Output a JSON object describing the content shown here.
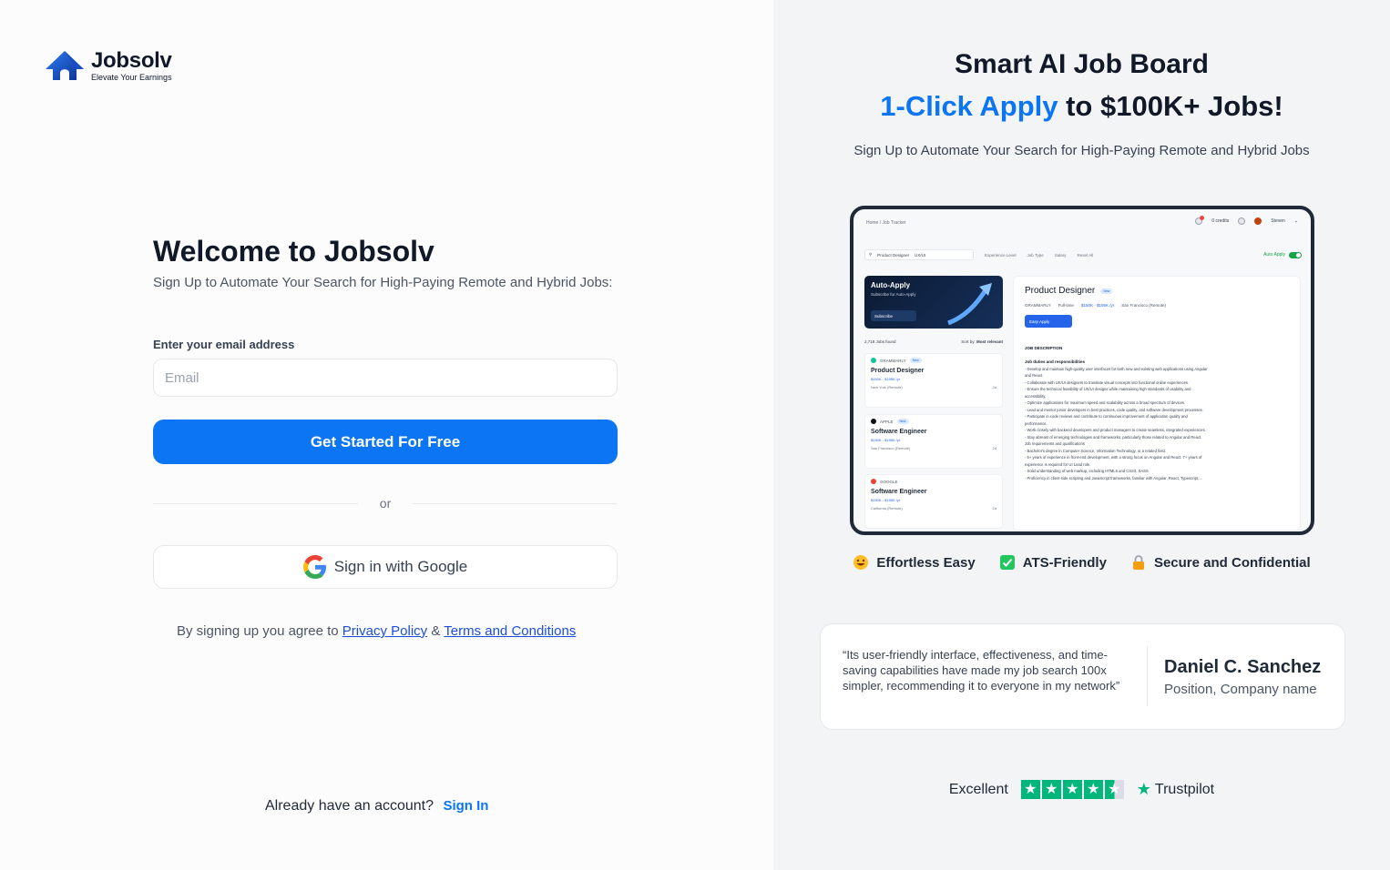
{
  "brand": {
    "name": "Jobsolv",
    "tagline": "Elevate Your Earnings"
  },
  "signup": {
    "title": "Welcome to Jobsolv",
    "subtitle": "Sign Up to Automate Your Search for High-Paying Remote and Hybrid Jobs:",
    "email_label": "Enter your email address",
    "email_placeholder": "Email",
    "email_value": "",
    "cta_label": "Get Started For Free",
    "or_label": "or",
    "google_label": "Sign in with Google",
    "agree_prefix": "By signing up you agree to",
    "privacy_label": "Privacy Policy",
    "amp": "&",
    "terms_label": "Terms and Conditions",
    "already_label": "Already have an account?",
    "signin_label": "Sign In"
  },
  "hero": {
    "title": "Smart AI Job Board",
    "title2_highlight": "1-Click Apply",
    "title2_rest": " to $100K+ Jobs!",
    "subtitle": "Sign Up to Automate Your Search for High-Paying Remote and Hybrid Jobs"
  },
  "preview": {
    "breadcrumb": "Home / Job Tracker",
    "credits": "0 credits",
    "user": "Steven",
    "search_chip1": "Product Designer",
    "search_chip2": "UX/UI",
    "filters": [
      "Experience Level",
      "Job Type",
      "Salary",
      "Reset All"
    ],
    "auto_apply_label": "Auto Apply",
    "promo_title": "Auto-Apply",
    "promo_sub": "Subscribe for Auto-Apply",
    "promo_btn": "Subscribe",
    "jobs_found": "2,718 Jobs found",
    "sort_label": "Sort by:",
    "sort_value": "Most relevant",
    "new_badge": "New",
    "jobs": [
      {
        "company": "GRAMMARLY",
        "title": "Product Designer",
        "salary": "$150K - $195K /yr",
        "location": "New York (Remote)",
        "age": "2d",
        "logo_color": "#15c39a"
      },
      {
        "company": "APPLE",
        "title": "Software Engineer",
        "salary": "$150K - $195K /yr",
        "location": "San Francisco (Remote)",
        "age": "2d",
        "logo_color": "#111111"
      },
      {
        "company": "GOOGLE",
        "title": "Software Engineer",
        "salary": "$150K - $195K /yr",
        "location": "California (Remote)",
        "age": "2d",
        "logo_color": "#ea4335"
      }
    ],
    "detail": {
      "title": "Product Designer",
      "company": "GRAMMARLY",
      "job_type": "Full-time",
      "salary": "$150K - $195K /yr",
      "location": "San Francisco (Remote)",
      "apply_label": "Easy Apply",
      "section": "JOB DESCRIPTION",
      "duties_title": "Job duties and responsibilities",
      "lines": [
        "- Develop and maintain high-quality user interfaces for both new and existing web applications using Angular",
        "and React.",
        "- Collaborate with UX/UI designers to translate visual concepts into functional online experiences.",
        "- Ensure the technical feasibility of UX/UI designs while maintaining high standards of usability and",
        "accessibility.",
        "- Optimize applications for maximum speed and scalability across a broad spectrum of devices.",
        "- Lead and mentor junior developers in best practices, code quality, and software development processes.",
        "- Participate in code reviews and contribute to continuous improvement of application quality and",
        "performance.",
        "- Work closely with backend developers and product managers to create seamless, integrated experiences.",
        "- Stay abreast of emerging technologies and frameworks, particularly those related to Angular and React.",
        "Job requirements and qualifications",
        "- Bachelor's degree in Computer Science, Information Technology, or a related field.",
        "- 5+ years of experience in front-end development, with a strong focus on Angular and React. 7+ years of",
        "experience is required for UI Lead role.",
        "- Solid understanding of web markup, including HTML5 and CSS3, SASS.",
        "- Proficiency in client-side scripting and JavaScript frameworks, familiar with Angular, React, Typescript,..."
      ]
    }
  },
  "features": [
    {
      "icon": "grin-face-icon",
      "glyph": "😄",
      "label": "Effortless Easy"
    },
    {
      "icon": "checkmark-box-icon",
      "glyph": "✓",
      "label": "ATS-Friendly"
    },
    {
      "icon": "lock-icon",
      "glyph": "🔒",
      "label": "Secure and Confidential"
    }
  ],
  "testimonial": {
    "quote": "“Its user-friendly interface, effectiveness, and time-saving capabilities have made my job search 100x simpler, recommending it to everyone in my network”",
    "name": "Daniel C. Sanchez",
    "position": "Position, Company name"
  },
  "rating": {
    "label": "Excellent",
    "stars": 4.5,
    "provider": "Trustpilot"
  },
  "colors": {
    "accent": "#0b75f3",
    "trustpilot_green": "#00b67a",
    "right_bg": "#f3f4f6"
  }
}
